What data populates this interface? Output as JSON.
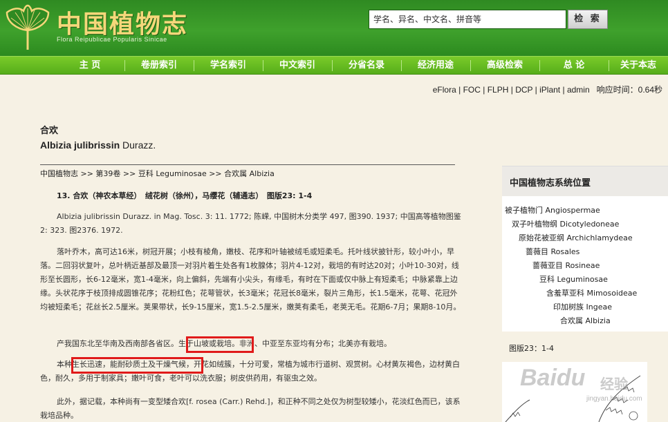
{
  "header": {
    "logo_cn": "中国植物志",
    "logo_en": "Flora Reipublicae Popularis Sinicae",
    "search_placeholder": "学名、异名、中文名、拼音等",
    "search_button": "检 索"
  },
  "nav": {
    "items": [
      "主 页",
      "卷册索引",
      "学名索引",
      "中文索引",
      "分省名录",
      "经济用途",
      "高级检索",
      "总 论",
      "关于本志"
    ]
  },
  "toplinks": {
    "eflora": "eFlora",
    "foc": "FOC",
    "flph": "FLPH",
    "dcp": "DCP",
    "iplant": "iPlant",
    "admin": "admin",
    "response_label": "响应时间：0.64秒"
  },
  "species": {
    "cn_name": "合欢",
    "sci_name_genus_species": "Albizia julibrissin",
    "sci_name_author": "Durazz."
  },
  "breadcrumb": "中国植物志 >> 第39卷 >> 豆科 Leguminosae >> 合欢属 Albizia",
  "heading": "13. 合欢（神农本草经）　绒花树（徐州），马缨花（辅通志）　图版23: 1-4",
  "paragraphs": {
    "citation": "Albizia julibrissin Durazz. in Mag. Tosc. 3: 11. 1772; 陈嵘, 中国树木分类学 497, 图390. 1937; 中国高等植物图鉴 2: 323. 图2376. 1972.",
    "description": "落叶乔木，高可达16米，树冠开展；小枝有棱角，嫩枝、花序和叶轴被绒毛或短柔毛。托叶线状披针形，较小叶小，早落。二回羽状复叶，总叶柄近基部及最顶一对羽片着生处各有1枚腺体；羽片4-12对，栽培的有时达20对；小叶10-30对，线形至长圆形，长6-12毫米，宽1-4毫米，向上偏斜，先端有小尖头，有缘毛，有时在下面或仅中脉上有短柔毛；中脉紧靠上边缘。头状花序于枝顶排成圆锥花序；花粉红色；花萼管状，长3毫米；花冠长8毫米，裂片三角形，长1.5毫米，花萼、花冠外均被短柔毛；花丝长2.5厘米。荚果带状，长9-15厘米，宽1.5-2.5厘米，嫩荚有柔毛，老荚无毛。花期6-7月；果期8-10月。",
    "distribution": "产我国东北至华南及西南部各省区。生于山坡或栽培。非洲、中亚至东亚均有分布；北美亦有栽培。",
    "usage": "本种生长迅速，能耐砂质土及干燥气候，开花如绒簇，十分可爱，常植为城市行道树、观赏树。心材黄灰褐色，边材黄白色，耐久，多用于制家具；嫩叶可食，老叶可以洗衣服；树皮供药用，有驱虫之效。",
    "variant": "此外，据记载，本种尚有一变型矮合欢[f. rosea (Carr.) Rehd.]，和正种不同之处仅为树型较矮小，花淡红色而已，该系栽培品种。"
  },
  "sidebar": {
    "title": "中国植物志系统位置",
    "tree": [
      "被子植物门 Angiospermae",
      "双子叶植物纲 Dicotyledoneae",
      "原始花被亚纲 Archichlamydeae",
      "蔷薇目 Rosales",
      "蔷薇亚目 Rosineae",
      "豆科 Leguminosae",
      "含羞草亚科 Mimosoideae",
      "印加树族 Ingeae",
      "合欢属 Albizia"
    ],
    "figure_label": "图版23：1-4"
  },
  "watermark": {
    "brand": "Baidu",
    "cn": "经验",
    "sub": "jingyan.baidu.com"
  },
  "colors": {
    "header_green": "#2f8a22",
    "nav_green": "#56ad1a",
    "logo_gold": "#f5d77a",
    "page_bg": "#f6f1e4",
    "highlight_red": "#e01a1a"
  }
}
